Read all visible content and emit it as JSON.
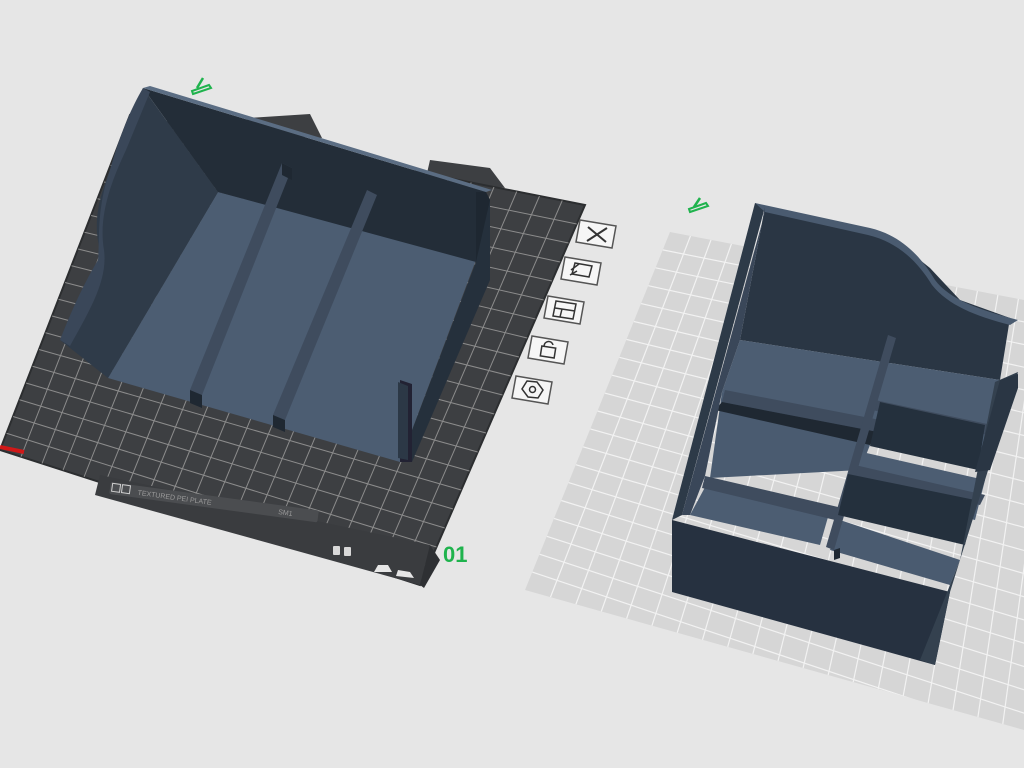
{
  "viewport": {
    "background": "#e6e6e6"
  },
  "plates": [
    {
      "label": "01",
      "state": "active",
      "bed_color": "#3d3f42",
      "grid_color": "#8c8c8c",
      "label_color": "#1fb34d",
      "bed_caption": "TEXTURED PEI PLATE",
      "bed_caption_right": "SM1",
      "object": {
        "name": "three-compartment-organizer",
        "color": "#4a5b70"
      }
    },
    {
      "label": "",
      "state": "inactive",
      "bed_color": "#d6d6d6",
      "grid_color": "#f2f2f2",
      "object": {
        "name": "six-compartment-organizer",
        "color": "#4a5b70"
      }
    }
  ],
  "plate_toolbar": {
    "buttons": [
      {
        "name": "delete-plate",
        "icon": "close-icon"
      },
      {
        "name": "arrange-plate",
        "icon": "arrange-icon"
      },
      {
        "name": "plate-settings",
        "icon": "layout-icon"
      },
      {
        "name": "lock-plate",
        "icon": "unlock-icon"
      },
      {
        "name": "plate-type",
        "icon": "hexagon-icon"
      }
    ]
  },
  "edit_markers": [
    {
      "icon": "pencil-icon",
      "color": "#1fb34d"
    },
    {
      "icon": "pencil-icon",
      "color": "#1fb34d"
    }
  ]
}
